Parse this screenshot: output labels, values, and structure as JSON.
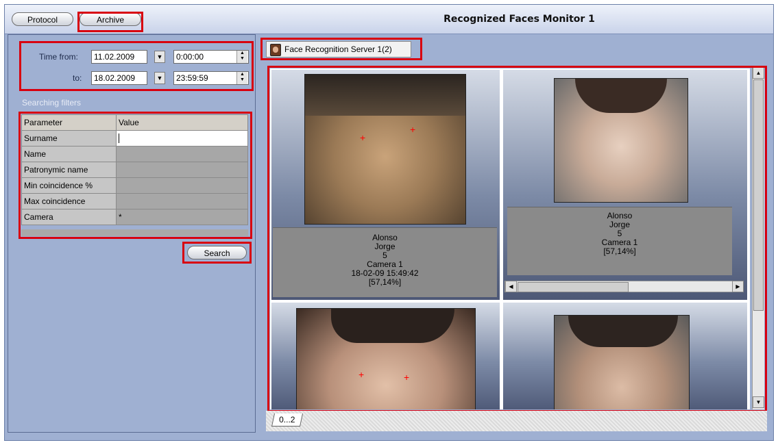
{
  "window": {
    "title": "Recognized Faces Monitor 1"
  },
  "toolbar": {
    "protocol_label": "Protocol",
    "archive_label": "Archive"
  },
  "time": {
    "from_label": "Time from:",
    "to_label": "to:",
    "from_date": "11.02.2009",
    "from_time": "0:00:00",
    "to_date": "18.02.2009",
    "to_time": "23:59:59"
  },
  "filters": {
    "heading": "Searching filters",
    "col_parameter": "Parameter",
    "col_value": "Value",
    "rows": [
      {
        "param": "Surname",
        "value": ""
      },
      {
        "param": "Name",
        "value": ""
      },
      {
        "param": "Patronymic name",
        "value": ""
      },
      {
        "param": "Min coincidence %",
        "value": ""
      },
      {
        "param": "Max coincidence",
        "value": ""
      },
      {
        "param": "Camera",
        "value": "*"
      }
    ],
    "search_label": "Search"
  },
  "server_tab": {
    "label": "Face Recognition Server 1(2)"
  },
  "results": [
    {
      "surname": "Alonso",
      "name": "Jorge",
      "number": "5",
      "camera": "Camera 1",
      "datetime": "18-02-09 15:49:42",
      "coincidence": "[57,14%]"
    },
    {
      "surname": "Alonso",
      "name": "Jorge",
      "number": "5",
      "camera": "Camera 1",
      "coincidence": "[57,14%]"
    }
  ],
  "pages": {
    "label": "0...2"
  },
  "colors": {
    "highlight": "#d8000f",
    "panel": "#9fb0d2"
  },
  "icons": [
    "face-icon",
    "calendar-dropdown-icon",
    "spin-up-icon",
    "spin-down-icon",
    "scroll-up-icon",
    "scroll-down-icon",
    "scroll-left-icon",
    "scroll-right-icon"
  ]
}
